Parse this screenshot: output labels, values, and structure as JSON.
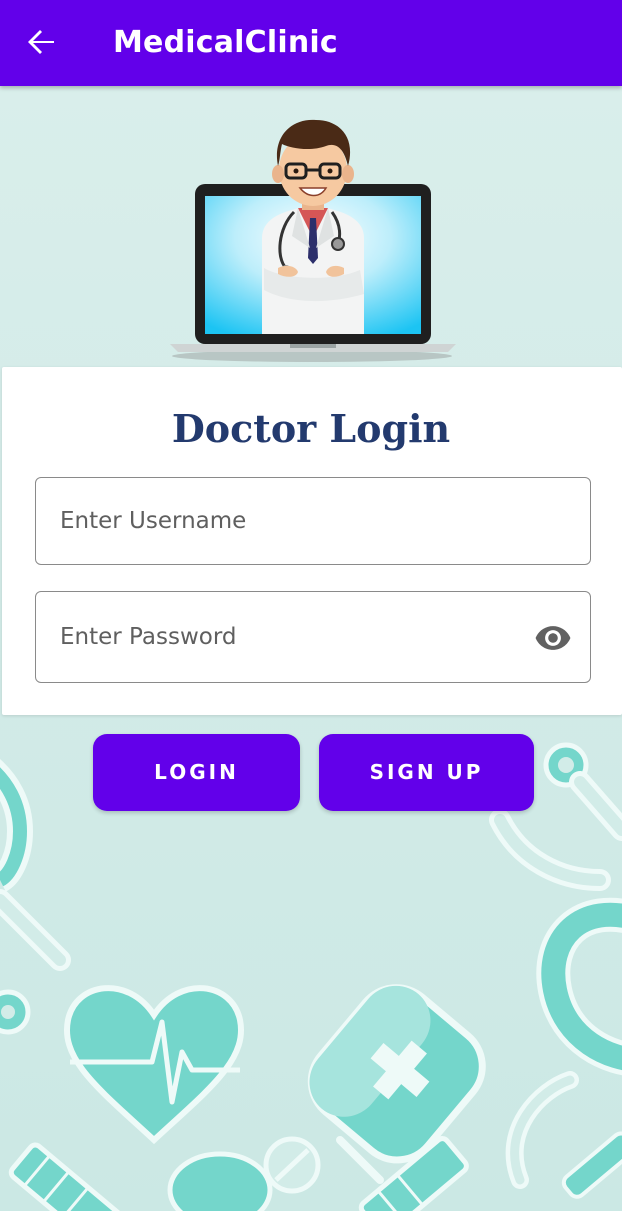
{
  "app_bar": {
    "title": "MedicalClinic",
    "back_icon": "arrow-left-icon",
    "color": "#6200ea"
  },
  "login_form": {
    "title": "Doctor Login",
    "username": {
      "placeholder": "Enter Username",
      "value": ""
    },
    "password": {
      "placeholder": "Enter Password",
      "value": "",
      "toggle_icon": "eye-icon"
    }
  },
  "actions": {
    "login_label": "LOGIN",
    "signup_label": "SIGN UP"
  },
  "theme": {
    "accent": "#6200ea",
    "background": "#d8eeea",
    "title_color": "#233a6e",
    "pattern_color": "#74d6cb"
  }
}
